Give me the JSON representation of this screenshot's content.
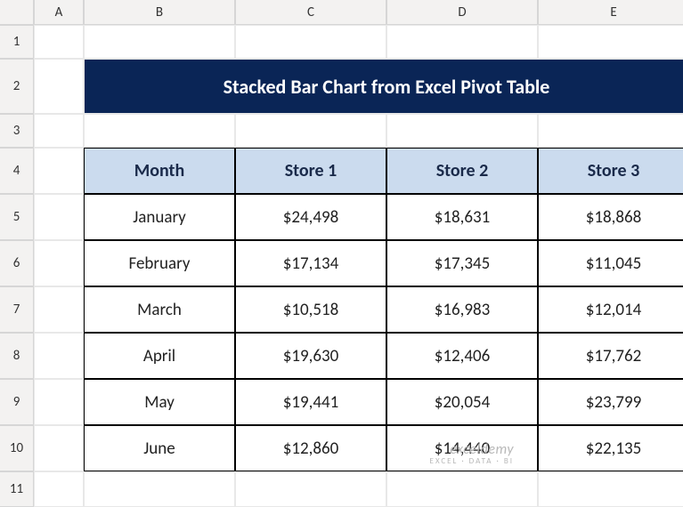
{
  "columns": [
    "A",
    "B",
    "C",
    "D",
    "E"
  ],
  "rows": [
    "1",
    "2",
    "3",
    "4",
    "5",
    "6",
    "7",
    "8",
    "9",
    "10",
    "11"
  ],
  "title": "Stacked Bar Chart from Excel Pivot Table",
  "table": {
    "headers": [
      "Month",
      "Store 1",
      "Store 2",
      "Store 3"
    ],
    "data": [
      [
        "January",
        "$24,498",
        "$18,631",
        "$18,868"
      ],
      [
        "February",
        "$17,134",
        "$17,345",
        "$11,045"
      ],
      [
        "March",
        "$10,518",
        "$16,983",
        "$12,014"
      ],
      [
        "April",
        "$19,630",
        "$12,406",
        "$17,762"
      ],
      [
        "May",
        "$19,441",
        "$20,054",
        "$23,799"
      ],
      [
        "June",
        "$12,860",
        "$14,440",
        "$22,135"
      ]
    ]
  },
  "watermark": {
    "line1": "exceldemy",
    "line2": "EXCEL · DATA · BI"
  },
  "chart_data": {
    "type": "table",
    "categories": [
      "January",
      "February",
      "March",
      "April",
      "May",
      "June"
    ],
    "series": [
      {
        "name": "Store 1",
        "values": [
          24498,
          17134,
          10518,
          19630,
          19441,
          12860
        ]
      },
      {
        "name": "Store 2",
        "values": [
          18631,
          17345,
          16983,
          12406,
          20054,
          14440
        ]
      },
      {
        "name": "Store 3",
        "values": [
          18868,
          11045,
          12014,
          17762,
          23799,
          22135
        ]
      }
    ],
    "title": "Stacked Bar Chart from Excel Pivot Table",
    "xlabel": "Month",
    "ylabel": ""
  }
}
